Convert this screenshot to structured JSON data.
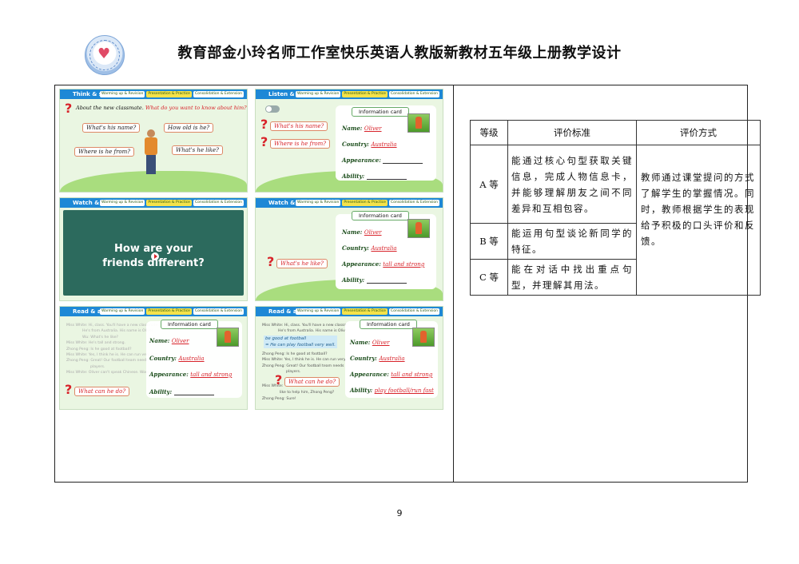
{
  "header": {
    "title": "教育部金小玲名师工作室快乐英语人教版新教材五年级上册教学设计",
    "logo_icon": "studio-seal-icon"
  },
  "stages": [
    "Warming up & Revision",
    "Presentation & Practice",
    "Consolidation & Extension"
  ],
  "slides": {
    "s1": {
      "title": "Think & say",
      "prompt_prefix": "About the new classmate.",
      "prompt_q": "What do you want to know about him?",
      "q1": "What's his name?",
      "q2": "How old is he?",
      "q3": "Where is he from?",
      "q4": "What's he like?"
    },
    "s2": {
      "title": "Listen & fill",
      "q1": "What's his name?",
      "q2": "Where is he from?",
      "card": "Information card",
      "name_label": "Name:",
      "name_val": "Oliver",
      "country_label": "Country:",
      "country_val": "Australia",
      "appearance_label": "Appearance:",
      "ability_label": "Ability:"
    },
    "s3": {
      "title": "Watch & answer",
      "video_line1": "How are your",
      "video_line2": "friends different?"
    },
    "s4": {
      "title": "Watch & answer",
      "q": "What's he like?",
      "card": "Information card",
      "name_label": "Name:",
      "name_val": "Oliver",
      "country_label": "Country:",
      "country_val": "Australia",
      "appearance_label": "Appearance:",
      "appearance_val": "tall and strong",
      "ability_label": "Ability:"
    },
    "s5": {
      "title": "Read & answer",
      "q": "What can he do?",
      "card": "Information card",
      "name_label": "Name:",
      "name_val": "Oliver",
      "country_label": "Country:",
      "country_val": "Australia",
      "appearance_label": "Appearance:",
      "appearance_val": "tall and strong",
      "ability_label": "Ability:",
      "dialog": [
        "Miss White:  Hi, class. You'll have a new classmate.",
        "He's from Australia. His name is Oliver.",
        "Wu: What's he like?",
        "Miss White: He's tall and strong.",
        "Zhong Peng: Is he good at football?",
        "Miss White: Yes, I think he is. He can run very fast.",
        "Zhong Peng: Great! Our football team needs more",
        "players.",
        "Miss White: Oliver can't speak Chinese. Would you"
      ]
    },
    "s6": {
      "title": "Read & answer",
      "q": "What can he do?",
      "card": "Information card",
      "name_label": "Name:",
      "name_val": "Oliver",
      "country_label": "Country:",
      "country_val": "Australia",
      "appearance_label": "Appearance:",
      "appearance_val": "tall and strong",
      "ability_label": "Ability:",
      "ability_val": "play football/run fast",
      "dialog_top1": "Miss White: Hi, class. You'll have a new classmate.",
      "dialog_top2": "He's from Australia. His name is Oliver.",
      "hl1": "be good at football",
      "hl2": "= He can play football very well.",
      "dialog": [
        "Zhong Peng: Is he good at football?",
        "Miss White: Yes, I think he is. He can run very fast.",
        "Zhong Peng: Great! Our football team needs more",
        "players."
      ],
      "miss": "Miss White:",
      "like": "like to help him, Zhong Peng?",
      "sure": "Zhong Peng: Sure!"
    }
  },
  "evaluation": {
    "headers": [
      "等级",
      "评价标准",
      "评价方式"
    ],
    "rows": [
      {
        "level": "A 等",
        "criteria": "能通过核心句型获取关键信息，完成人物信息卡，并能够理解朋友之间不同差异和互相包容。"
      },
      {
        "level": "B 等",
        "criteria": "能运用句型谈论新同学的特征。"
      },
      {
        "level": "C 等",
        "criteria": "能在对话中找出重点句型，并理解其用法。"
      }
    ],
    "method": "教师通过课堂提问的方式了解学生的掌握情况。同时，教师根据学生的表现给予积极的口头评价和反馈。"
  },
  "footer": {
    "page_number": "9"
  }
}
